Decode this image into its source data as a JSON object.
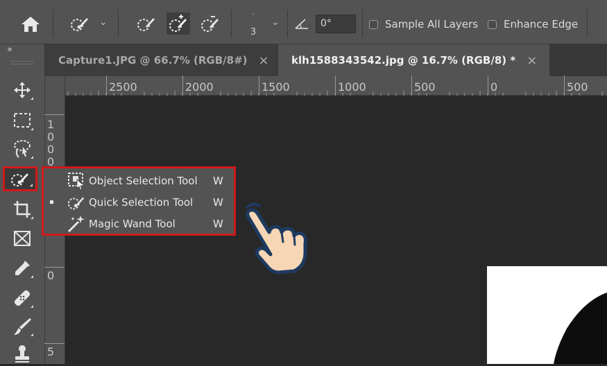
{
  "options_bar": {
    "home_icon": "home-icon",
    "brush_size": "3",
    "angle_value": "0°",
    "sample_all_layers": {
      "label": "Sample All Layers",
      "checked": false
    },
    "enhance_edge": {
      "label": "Enhance Edge",
      "checked": false
    }
  },
  "toolbox": {
    "expand_glyph": "»",
    "tools": [
      "move-icon",
      "marquee-icon",
      "lasso-icon",
      "quick-selection-icon",
      "crop-icon",
      "frame-icon",
      "eyedropper-icon",
      "healing-brush-icon",
      "brush-icon",
      "stamp-icon"
    ],
    "selected_tool": "quick-selection-icon"
  },
  "tabs": [
    {
      "label": "Capture1.JPG @ 66.7% (RGB/8#)",
      "close": "×",
      "active": false
    },
    {
      "label": "klh1588343542.jpg @ 16.7% (RGB/8) *",
      "close": "×",
      "active": true
    }
  ],
  "ruler_h": [
    "2500",
    "2000",
    "1500",
    "1000",
    "500",
    "0",
    "500"
  ],
  "ruler_v": {
    "stack1": [
      "1",
      "0",
      "0",
      "0"
    ],
    "zero": "0",
    "stack2": [
      "5"
    ]
  },
  "flyout": {
    "items": [
      {
        "label": "Object Selection Tool",
        "shortcut": "W",
        "icon": "object-selection-icon",
        "current": false
      },
      {
        "label": "Quick Selection Tool",
        "shortcut": "W",
        "icon": "quick-selection-icon",
        "current": true
      },
      {
        "label": "Magic Wand Tool",
        "shortcut": "W",
        "icon": "magic-wand-icon",
        "current": false
      }
    ]
  },
  "colors": {
    "highlight": "#d01919",
    "hand_fill": "#f6d6b5",
    "hand_outline": "#1e3a5f"
  }
}
